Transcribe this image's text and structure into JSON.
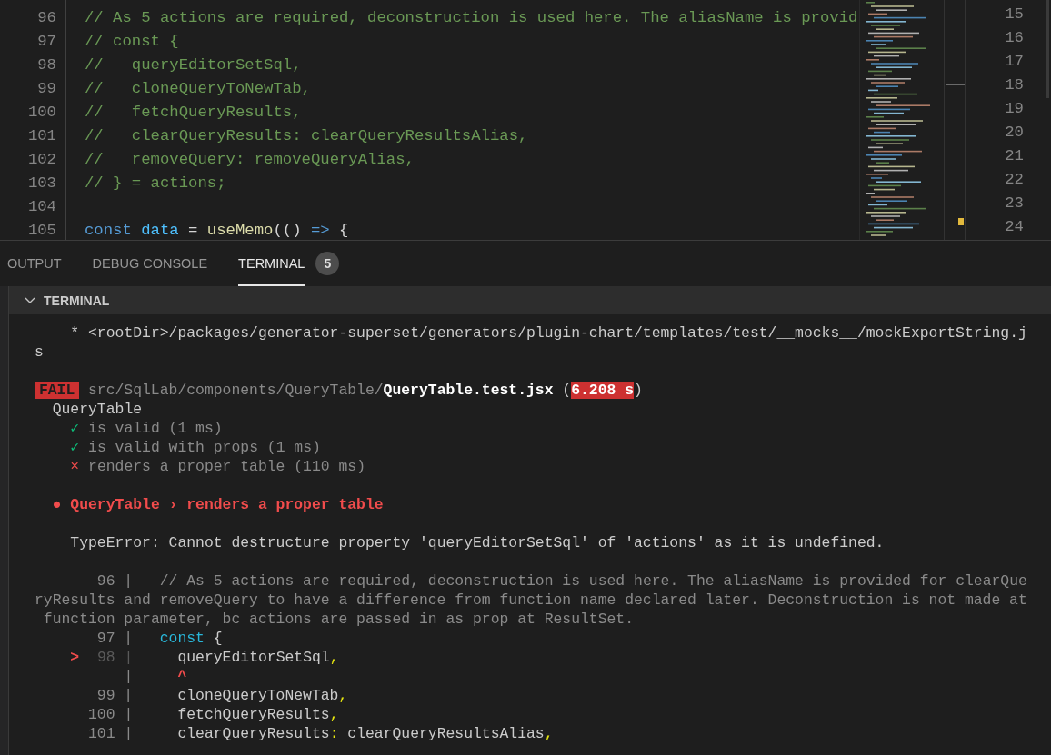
{
  "editor": {
    "lines": [
      {
        "number": "96",
        "tokens": [
          {
            "text": "// As 5 actions are required, deconstruction is used here. The aliasName is provid",
            "kind": "comment"
          }
        ]
      },
      {
        "number": "97",
        "tokens": [
          {
            "text": "// const {",
            "kind": "comment"
          }
        ]
      },
      {
        "number": "98",
        "tokens": [
          {
            "text": "//   queryEditorSetSql,",
            "kind": "comment"
          }
        ]
      },
      {
        "number": "99",
        "tokens": [
          {
            "text": "//   cloneQueryToNewTab,",
            "kind": "comment"
          }
        ]
      },
      {
        "number": "100",
        "tokens": [
          {
            "text": "//   fetchQueryResults,",
            "kind": "comment"
          }
        ]
      },
      {
        "number": "101",
        "tokens": [
          {
            "text": "//   clearQueryResults: clearQueryResultsAlias,",
            "kind": "comment"
          }
        ]
      },
      {
        "number": "102",
        "tokens": [
          {
            "text": "//   removeQuery: removeQueryAlias,",
            "kind": "comment"
          }
        ]
      },
      {
        "number": "103",
        "tokens": [
          {
            "text": "// } = actions;",
            "kind": "comment"
          }
        ]
      },
      {
        "number": "104"
      },
      {
        "number": "105",
        "tokens": [
          {
            "text": "const",
            "kind": "keyword"
          },
          {
            "text": " data",
            "kind": "variable"
          },
          {
            "text": " =",
            "kind": "plain"
          },
          {
            "text": " useMemo",
            "kind": "function"
          },
          {
            "text": "(()",
            "kind": "plain"
          },
          {
            "text": " =>",
            "kind": "keyword"
          },
          {
            "text": " {",
            "kind": "plain"
          }
        ]
      }
    ]
  },
  "side_editor": {
    "line_numbers": [
      "15",
      "16",
      "17",
      "18",
      "19",
      "20",
      "21",
      "22",
      "23",
      "24"
    ]
  },
  "panel": {
    "tabs": [
      {
        "label": "OUTPUT",
        "selected": false
      },
      {
        "label": "DEBUG CONSOLE",
        "selected": false
      },
      {
        "label": "TERMINAL",
        "selected": true,
        "badge": "5"
      }
    ],
    "section": {
      "title": "TERMINAL",
      "expanded": true
    },
    "terminal_lines": [
      {
        "segments": [
          {
            "text": "    * <rootDir>/packages/generator-superset/generators/plugin-chart/templates/test/__mocks__/mockExportString.j",
            "kind": "text"
          }
        ]
      },
      {
        "segments": [
          {
            "text": "s",
            "kind": "text"
          }
        ]
      },
      {
        "kind": "blank"
      },
      {
        "segments": [
          {
            "text": "FAIL",
            "kind": "fail-badge"
          },
          {
            "text": " src/SqlLab/components/QueryTable/",
            "kind": "dim"
          },
          {
            "text": "QueryTable.test.jsx",
            "kind": "bold"
          },
          {
            "text": " (",
            "kind": "text"
          },
          {
            "text": "6.208 s",
            "kind": "time-badge"
          },
          {
            "text": ")",
            "kind": "text"
          }
        ]
      },
      {
        "segments": [
          {
            "text": "  QueryTable",
            "kind": "text"
          }
        ]
      },
      {
        "segments": [
          {
            "text": "    ✓",
            "kind": "pass"
          },
          {
            "text": " is valid (1 ms)",
            "kind": "dim"
          }
        ]
      },
      {
        "segments": [
          {
            "text": "    ✓",
            "kind": "pass"
          },
          {
            "text": " is valid with props (1 ms)",
            "kind": "dim"
          }
        ]
      },
      {
        "segments": [
          {
            "text": "    ×",
            "kind": "failmark"
          },
          {
            "text": " renders a proper table (110 ms)",
            "kind": "dim"
          }
        ]
      },
      {
        "kind": "blank"
      },
      {
        "segments": [
          {
            "text": "  ● QueryTable › renders a proper table",
            "kind": "error"
          }
        ]
      },
      {
        "kind": "blank"
      },
      {
        "segments": [
          {
            "text": "    TypeError: Cannot destructure property 'queryEditorSetSql' of 'actions' as it is undefined.",
            "kind": "text"
          }
        ]
      },
      {
        "kind": "blank"
      },
      {
        "segments": [
          {
            "text": "       96 |",
            "kind": "linenum"
          },
          {
            "text": "   // As 5 actions are required, deconstruction is used here. The aliasName is provided for clearQue",
            "kind": "dim"
          }
        ]
      },
      {
        "segments": [
          {
            "text": "ryResults and removeQuery to have a difference from function name declared later. Deconstruction is not made at",
            "kind": "dim"
          }
        ]
      },
      {
        "segments": [
          {
            "text": " function parameter, bc actions are passed in as prop at ResultSet.",
            "kind": "dim"
          }
        ]
      },
      {
        "segments": [
          {
            "text": "       97 |",
            "kind": "linenum"
          },
          {
            "text": "   const",
            "kind": "keyword"
          },
          {
            "text": " {",
            "kind": "text"
          }
        ]
      },
      {
        "segments": [
          {
            "text": "    >",
            "kind": "marker"
          },
          {
            "text": "  98 |",
            "kind": "linenum-dim"
          },
          {
            "text": "     queryEditorSetSql",
            "kind": "text"
          },
          {
            "text": ",",
            "kind": "punct"
          }
        ]
      },
      {
        "segments": [
          {
            "text": "          |",
            "kind": "linenum"
          },
          {
            "text": "     ^",
            "kind": "caret"
          }
        ]
      },
      {
        "segments": [
          {
            "text": "       99 |",
            "kind": "linenum"
          },
          {
            "text": "     cloneQueryToNewTab",
            "kind": "text"
          },
          {
            "text": ",",
            "kind": "punct"
          }
        ]
      },
      {
        "segments": [
          {
            "text": "      100 |",
            "kind": "linenum"
          },
          {
            "text": "     fetchQueryResults",
            "kind": "text"
          },
          {
            "text": ",",
            "kind": "punct"
          }
        ]
      },
      {
        "segments": [
          {
            "text": "      101 |",
            "kind": "linenum"
          },
          {
            "text": "     clearQueryResults",
            "kind": "text"
          },
          {
            "text": ":",
            "kind": "punct"
          },
          {
            "text": " clearQueryResultsAlias",
            "kind": "text"
          },
          {
            "text": ",",
            "kind": "punct"
          }
        ]
      }
    ]
  }
}
